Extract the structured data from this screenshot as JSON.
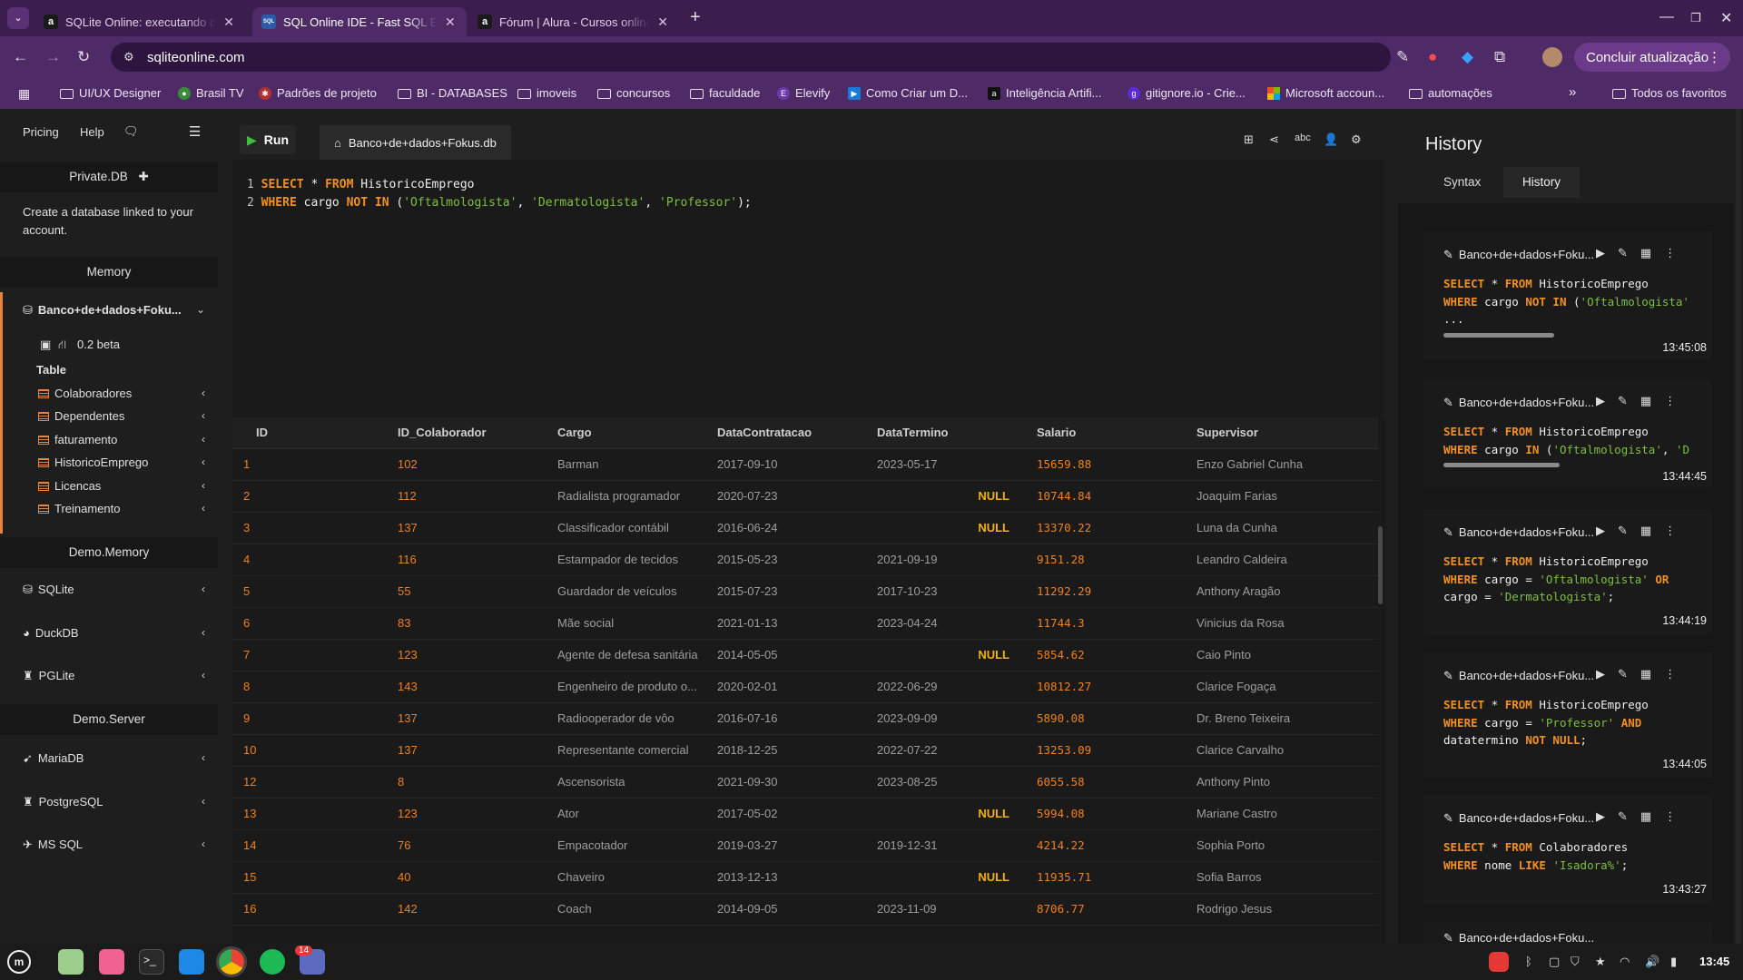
{
  "browser": {
    "tabs": [
      {
        "title": "SQLite Online: executando c",
        "favicon": "a",
        "active": false
      },
      {
        "title": "SQL Online IDE - Fast SQL Ed",
        "favicon": "SQL",
        "active": true
      },
      {
        "title": "Fórum | Alura - Cursos online",
        "favicon": "a",
        "active": false
      }
    ],
    "url": "sqliteonline.com",
    "update_button": "Concluir atualização",
    "bookmarks": [
      {
        "label": "UI/UX Designer",
        "icon": "folder-icon"
      },
      {
        "label": "Brasil TV",
        "icon": "tv-icon"
      },
      {
        "label": "Padrões de projeto",
        "icon": "site-icon"
      },
      {
        "label": "BI - DATABASES",
        "icon": "folder-icon"
      },
      {
        "label": "imoveis",
        "icon": "folder-icon"
      },
      {
        "label": "concursos",
        "icon": "folder-icon"
      },
      {
        "label": "faculdade",
        "icon": "folder-icon"
      },
      {
        "label": "Elevify",
        "icon": "site-icon"
      },
      {
        "label": "Como Criar um D...",
        "icon": "site-icon"
      },
      {
        "label": "Inteligência Artifi...",
        "icon": "site-icon"
      },
      {
        "label": "gitignore.io - Crie...",
        "icon": "site-icon"
      },
      {
        "label": "Microsoft accoun...",
        "icon": "microsoft-icon"
      },
      {
        "label": "automações",
        "icon": "folder-icon"
      }
    ],
    "all_bookmarks": "Todos os favoritos",
    "bookmarks_overflow": "»"
  },
  "sidebar": {
    "pricing": "Pricing",
    "help": "Help",
    "private_db": "Private.DB",
    "private_desc": "Create a database linked to your account.",
    "memory": "Memory",
    "db_name": "Banco+de+dados+Foku...",
    "version": "0.2 beta",
    "table_heading": "Table",
    "tables": [
      "Colaboradores",
      "Dependentes",
      "faturamento",
      "HistoricoEmprego",
      "Licencas",
      "Treinamento"
    ],
    "demo_memory": "Demo.Memory",
    "memory_engines": [
      "SQLite",
      "DuckDB",
      "PGLite"
    ],
    "demo_server": "Demo.Server",
    "server_engines": [
      "MariaDB",
      "PostgreSQL",
      "MS SQL"
    ]
  },
  "editor": {
    "run_label": "Run",
    "db_tab": "Banco+de+dados+Fokus.db",
    "line1_num": "1",
    "line2_num": "2"
  },
  "results": {
    "columns": [
      "ID",
      "ID_Colaborador",
      "Cargo",
      "DataContratacao",
      "DataTermino",
      "Salario",
      "Supervisor"
    ],
    "rows": [
      [
        "1",
        "102",
        "Barman",
        "2017-09-10",
        "2023-05-17",
        "15659.88",
        "Enzo Gabriel Cunha"
      ],
      [
        "2",
        "112",
        "Radialista programador",
        "2020-07-23",
        "NULL",
        "10744.84",
        "Joaquim Farias"
      ],
      [
        "3",
        "137",
        "Classificador contábil",
        "2016-06-24",
        "NULL",
        "13370.22",
        "Luna da Cunha"
      ],
      [
        "4",
        "116",
        "Estampador de tecidos",
        "2015-05-23",
        "2021-09-19",
        "9151.28",
        "Leandro Caldeira"
      ],
      [
        "5",
        "55",
        "Guardador de veículos",
        "2015-07-23",
        "2017-10-23",
        "11292.29",
        "Anthony Aragão"
      ],
      [
        "6",
        "83",
        "Mãe social",
        "2021-01-13",
        "2023-04-24",
        "11744.3",
        "Vinicius da Rosa"
      ],
      [
        "7",
        "123",
        "Agente de defesa sanitária",
        "2014-05-05",
        "NULL",
        "5854.62",
        "Caio Pinto"
      ],
      [
        "8",
        "143",
        "Engenheiro de produto o...",
        "2020-02-01",
        "2022-06-29",
        "10812.27",
        "Clarice Fogaça"
      ],
      [
        "9",
        "137",
        "Radiooperador de vôo",
        "2016-07-16",
        "2023-09-09",
        "5890.08",
        "Dr. Breno Teixeira"
      ],
      [
        "10",
        "137",
        "Representante comercial",
        "2018-12-25",
        "2022-07-22",
        "13253.09",
        "Clarice Carvalho"
      ],
      [
        "12",
        "8",
        "Ascensorista",
        "2021-09-30",
        "2023-08-25",
        "6055.58",
        "Anthony Pinto"
      ],
      [
        "13",
        "123",
        "Ator",
        "2017-05-02",
        "NULL",
        "5994.08",
        "Mariane Castro"
      ],
      [
        "14",
        "76",
        "Empacotador",
        "2019-03-27",
        "2019-12-31",
        "4214.22",
        "Sophia Porto"
      ],
      [
        "15",
        "40",
        "Chaveiro",
        "2013-12-13",
        "NULL",
        "11935.71",
        "Sofia Barros"
      ],
      [
        "16",
        "142",
        "Coach",
        "2014-09-05",
        "2023-11-09",
        "8706.77",
        "Rodrigo Jesus"
      ]
    ]
  },
  "history": {
    "title": "History",
    "tab_syntax": "Syntax",
    "tab_history": "History",
    "card_db": "Banco+de+dados+Foku...",
    "times": [
      "13:45:08",
      "13:44:45",
      "13:44:19",
      "13:44:05",
      "13:43:27"
    ],
    "scroll_fractions": [
      0.42,
      0.44
    ]
  },
  "taskbar": {
    "clock": "13:45",
    "badge": "14"
  },
  "colors": {
    "tab_strip": "#3b1d4e",
    "toolbar": "#4e2a66",
    "keyword": "#f29024",
    "string": "#7fbf3f",
    "null": "#f2b20a",
    "sidebar_accent": "#e8833a"
  }
}
